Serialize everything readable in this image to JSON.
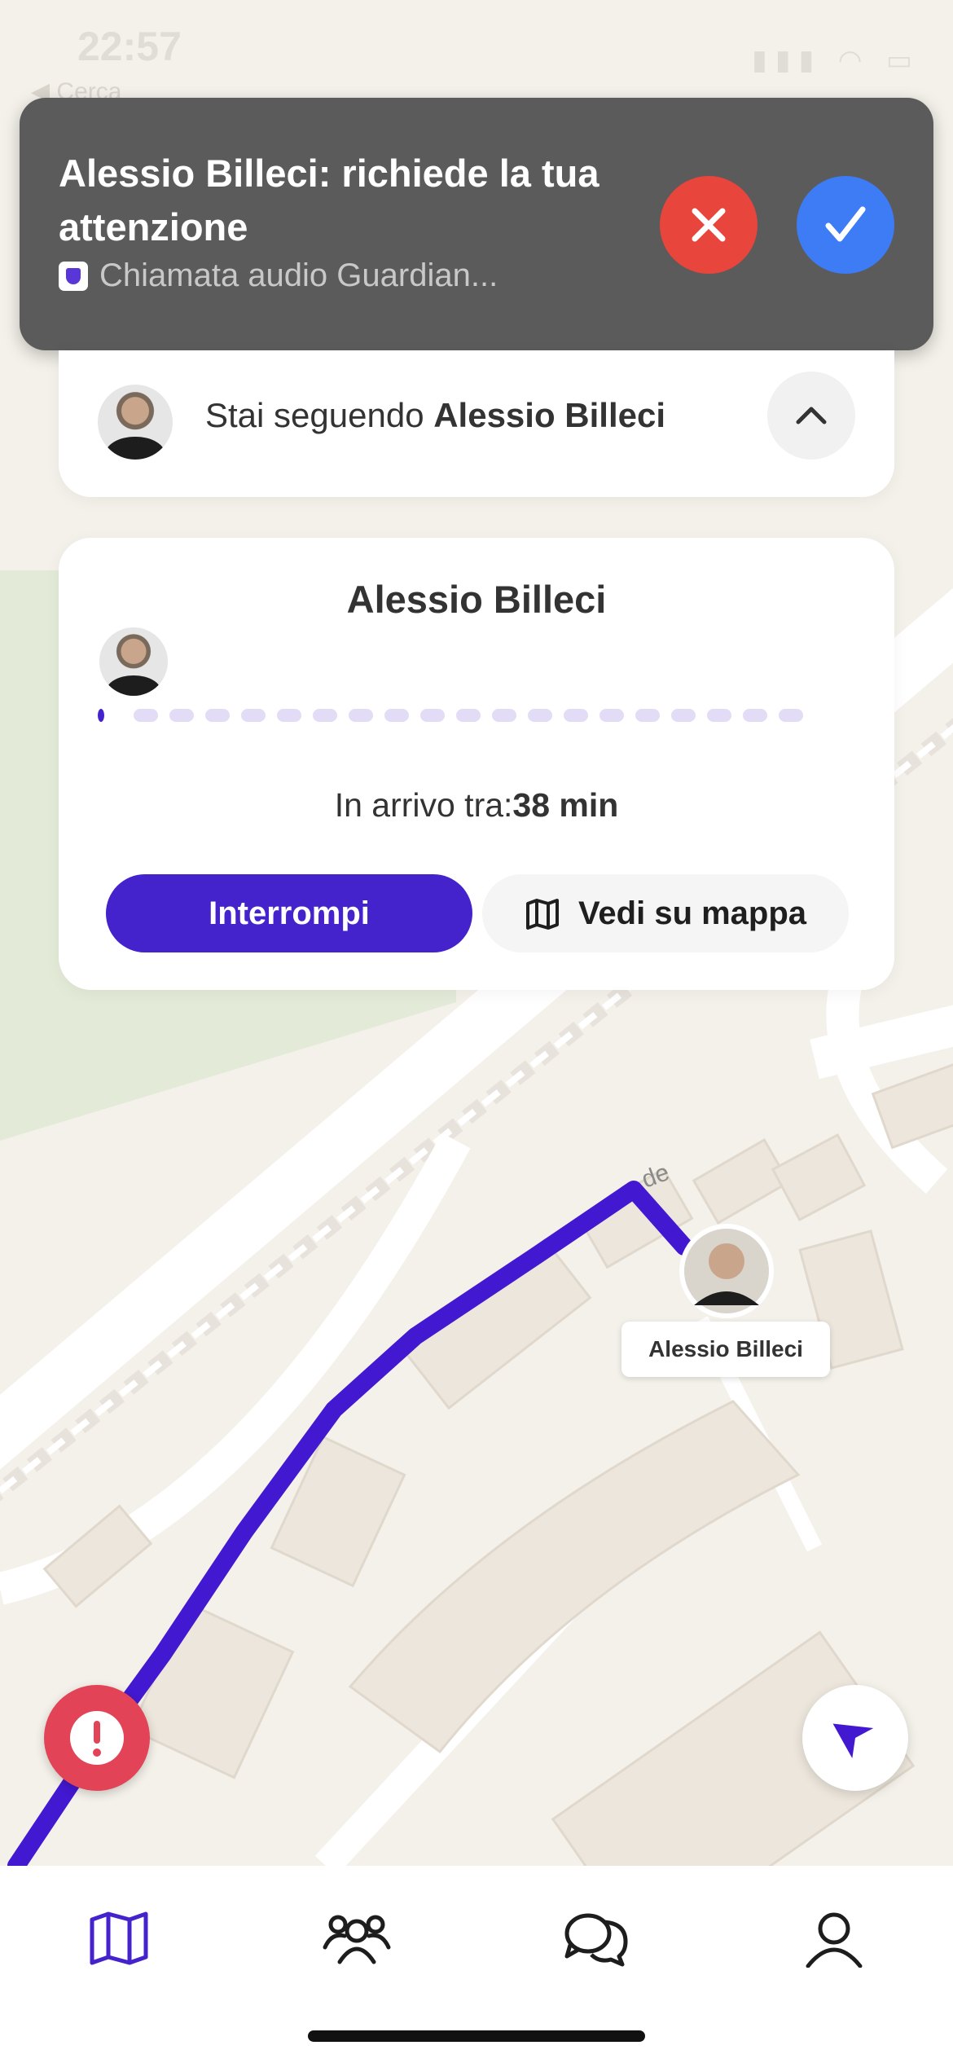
{
  "status_bar": {
    "time": "22:57",
    "back_label": "◀ Cerca",
    "icons": "▮▮▮ ◠ ▭"
  },
  "notification": {
    "title": "Alessio Billeci: richiede la tua attenzione",
    "subtitle": "Chiamata audio Guardian..."
  },
  "following": {
    "prefix": "Stai seguendo ",
    "name": "Alessio Billeci"
  },
  "tracking_card": {
    "name": "Alessio Billeci",
    "progress_fraction": 0.0,
    "eta_label": "In arrivo tra:",
    "eta_value": "38 min",
    "stop_button": "Interrompi",
    "map_button": "Vedi su mappa"
  },
  "map": {
    "marker_label": "Alessio Billeci",
    "road_label": "de"
  },
  "tabs": [
    {
      "name": "map",
      "icon": "map-icon",
      "active": true
    },
    {
      "name": "people",
      "icon": "people-icon",
      "active": false
    },
    {
      "name": "chat",
      "icon": "chat-icon",
      "active": false
    },
    {
      "name": "profile",
      "icon": "profile-icon",
      "active": false
    }
  ],
  "colors": {
    "accent": "#4422cc",
    "decline": "#e8453c",
    "accept": "#3d7cf4",
    "sos": "#e24357",
    "route": "#4318d1"
  }
}
